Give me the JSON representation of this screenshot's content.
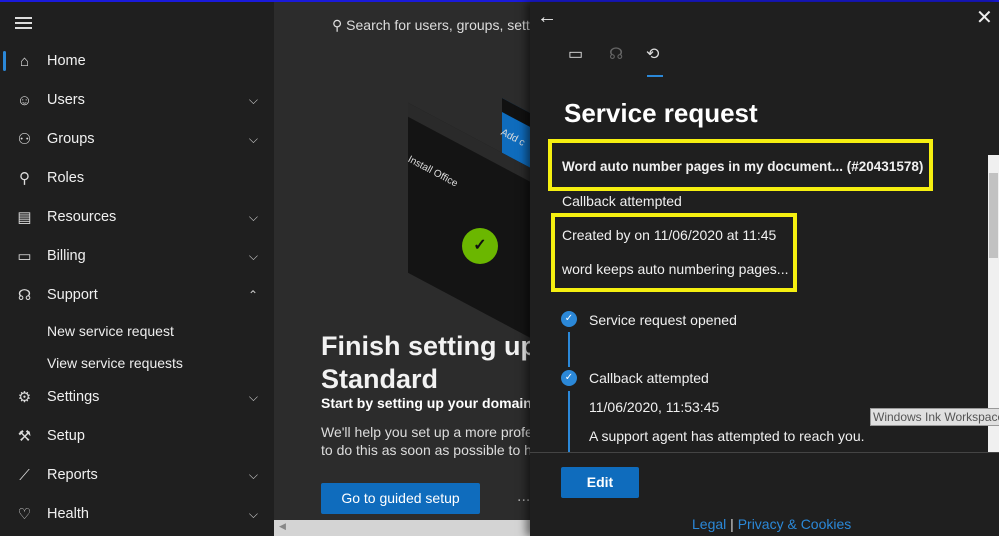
{
  "sidebar": {
    "items": [
      {
        "label": "Home",
        "icon": "home-icon",
        "chev": ""
      },
      {
        "label": "Users",
        "icon": "user-icon",
        "chev": "down"
      },
      {
        "label": "Groups",
        "icon": "groups-icon",
        "chev": "down"
      },
      {
        "label": "Roles",
        "icon": "roles-icon",
        "chev": ""
      },
      {
        "label": "Resources",
        "icon": "resources-icon",
        "chev": "down"
      },
      {
        "label": "Billing",
        "icon": "billing-icon",
        "chev": "down"
      },
      {
        "label": "Support",
        "icon": "headset-icon",
        "chev": "up"
      },
      {
        "label": "Settings",
        "icon": "gear-icon",
        "chev": "down"
      },
      {
        "label": "Setup",
        "icon": "wrench-icon",
        "chev": ""
      },
      {
        "label": "Reports",
        "icon": "chart-icon",
        "chev": "down"
      },
      {
        "label": "Health",
        "icon": "heart-icon",
        "chev": "down"
      }
    ],
    "support_sub": [
      "New service request",
      "View service requests"
    ]
  },
  "main": {
    "search_placeholder": "Search for users, groups, sett",
    "illus_label1": "Install Office",
    "illus_label2": "Add c",
    "title_line1": "Finish setting up",
    "title_line2": "Standard",
    "subtitle": "Start by setting up your domain",
    "desc_line1": "We'll help you set up a more profes",
    "desc_line2": "to do this as soon as possible to he",
    "cta": "Go to guided setup",
    "more": "..."
  },
  "panel": {
    "title": "Service request",
    "request_title": "Word auto number pages in my document... (#20431578)",
    "status": "Callback attempted",
    "created": "Created by   on 11/06/2020 at 11:45",
    "description": "word keeps auto numbering pages...",
    "timeline": [
      {
        "label": "Service request opened"
      },
      {
        "label": "Callback attempted",
        "time": "11/06/2020, 11:53:45",
        "detail": "A support agent has attempted to reach you."
      }
    ],
    "edit": "Edit",
    "legal": "Legal",
    "sep": "|",
    "privacy": "Privacy & Cookies",
    "tooltip": "Windows Ink Workspace"
  },
  "colors": {
    "accent": "#0f6cbd",
    "highlight": "#f5ef10"
  }
}
